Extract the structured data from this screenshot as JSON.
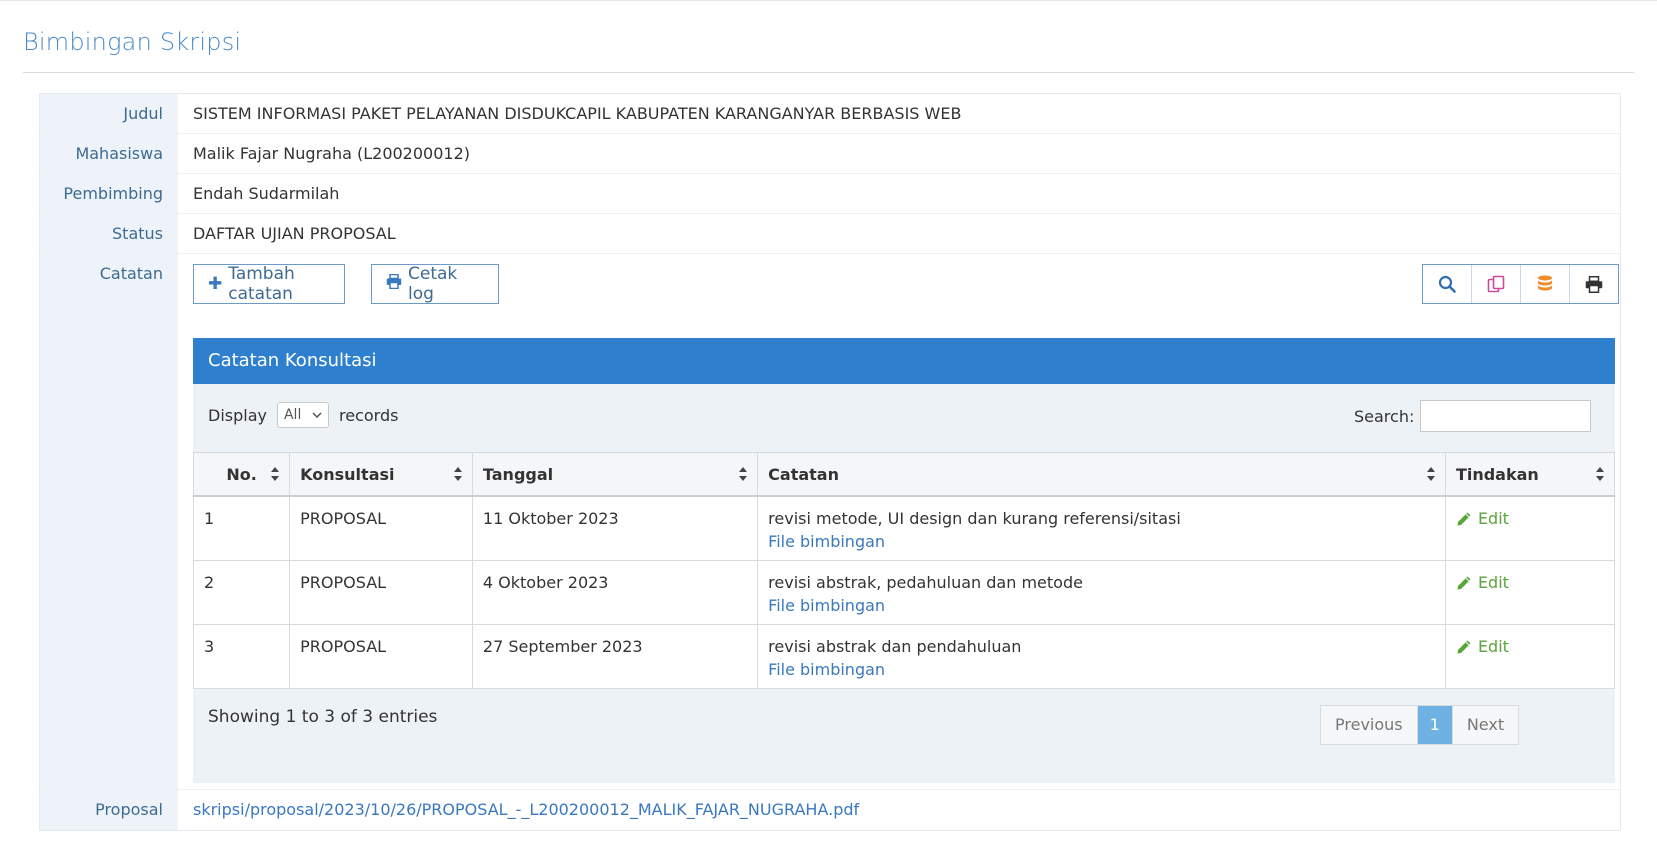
{
  "page": {
    "title": "Bimbingan Skripsi"
  },
  "info": {
    "judul_label": "Judul",
    "judul": "SISTEM INFORMASI PAKET PELAYANAN DISDUKCAPIL KABUPATEN KARANGANYAR BERBASIS WEB",
    "mahasiswa_label": "Mahasiswa",
    "mahasiswa": "Malik Fajar Nugraha (L200200012)",
    "pembimbing_label": "Pembimbing",
    "pembimbing": "Endah Sudarmilah",
    "status_label": "Status",
    "status": "DAFTAR UJIAN PROPOSAL",
    "catatan_label": "Catatan",
    "proposal_label": "Proposal",
    "proposal_link": "skripsi/proposal/2023/10/26/PROPOSAL_-_L200200012_MALIK_FAJAR_NUGRAHA.pdf"
  },
  "toolbar": {
    "add_label": "Tambah catatan",
    "print_label": "Cetak log",
    "icons": [
      "search-icon",
      "copy-icon",
      "database-icon",
      "print-icon"
    ]
  },
  "panel": {
    "title": "Catatan Konsultasi",
    "display_label": "Display",
    "display_value": "All",
    "records_label": "records",
    "search_label": "Search:",
    "columns": [
      "No.",
      "Konsultasi",
      "Tanggal",
      "Catatan",
      "Tindakan"
    ],
    "rows": [
      {
        "no": "1",
        "konsultasi": "PROPOSAL",
        "tanggal": "11 Oktober 2023",
        "catatan": "revisi metode, UI design dan kurang referensi/sitasi",
        "file": "File bimbingan",
        "action": "Edit"
      },
      {
        "no": "2",
        "konsultasi": "PROPOSAL",
        "tanggal": "4 Oktober 2023",
        "catatan": "revisi abstrak, pedahuluan dan metode",
        "file": "File bimbingan",
        "action": "Edit"
      },
      {
        "no": "3",
        "konsultasi": "PROPOSAL",
        "tanggal": "27 September 2023",
        "catatan": "revisi abstrak dan pendahuluan",
        "file": "File bimbingan",
        "action": "Edit"
      }
    ],
    "showing": "Showing 1 to 3 of 3 entries",
    "pagination": {
      "previous": "Previous",
      "current": "1",
      "next": "Next"
    }
  },
  "colors": {
    "accent": "#2f7fcf",
    "label_bg": "#edf3f8",
    "link": "#3a78c0",
    "edit": "#5aa53a",
    "pager_active": "#6fb1e3"
  }
}
